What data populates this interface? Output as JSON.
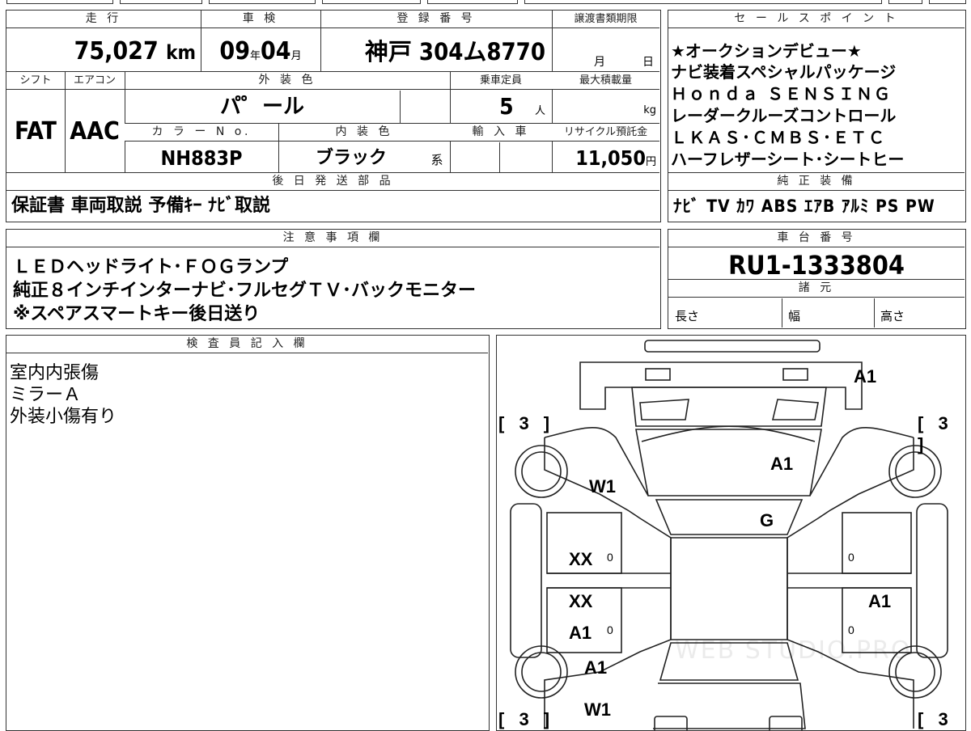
{
  "summary": {
    "headers": {
      "mileage": "走 行",
      "inspection": "車 検",
      "registration": "登 録 番 号",
      "transfer_deadline": "譲渡書類期限",
      "shift": "シフト",
      "aircon": "エアコン",
      "exterior_color": "外 装 色",
      "capacity": "乗車定員",
      "max_load": "最大積載量",
      "color_no": "カ ラ ー N o.",
      "interior_color": "内 装 色",
      "import": "輸 入 車",
      "recycle_fee": "リサイクル預託金",
      "later_parts": "後 日 発 送 部 品"
    },
    "mileage_value": "75,027",
    "mileage_unit": "km",
    "inspection_year": "09",
    "inspection_year_unit": "年",
    "inspection_month": "04",
    "inspection_month_unit": "月",
    "registration_value": "神戸 304ム8770",
    "transfer_month_unit": "月",
    "transfer_day_unit": "日",
    "shift_value": "FAT",
    "aircon_value": "AAC",
    "exterior_color_value": "パ゜ール",
    "capacity_value": "5",
    "capacity_unit": "人",
    "max_load_unit": "kg",
    "color_no_value": "NH883P",
    "interior_color_value": "ブラック",
    "interior_color_suffix": "系",
    "recycle_value": "11,050",
    "recycle_unit": "円",
    "later_parts_value": "保証書 車両取説 予備ｷｰ ﾅﾋﾞ取説"
  },
  "sales_points": {
    "header": "セ ー ル ス ポ イ ン ト",
    "lines": [
      "★オークションデビュー★",
      "ナビ装着スペシャルパッケージ",
      "Ｈｏｎｄａ ＳＥＮＳＩＮＧ",
      "レーダークルーズコントロール",
      "ＬＫＡＳ･ＣＭＢＳ･ＥＴＣ",
      "ハーフレザーシート･シートヒー"
    ]
  },
  "equipment": {
    "header": "純 正 装 備",
    "value": "ﾅﾋﾞ TV ｶﾜ ABS ｴｱB ｱﾙﾐ PS PW"
  },
  "notes": {
    "header": "注 意 事 項 欄",
    "lines": [
      "ＬＥＤヘッドライト･ＦＯＧランプ",
      "純正８インチインターナビ･フルセグＴＶ･バックモニター",
      "※スペアスマートキー後日送り"
    ]
  },
  "chassis": {
    "header": "車 台 番 号",
    "value": "RU1-1333804",
    "specs_header": "諸 元",
    "length_label": "長さ",
    "width_label": "幅",
    "height_label": "高さ"
  },
  "inspector": {
    "header": "検 査 員 記 入 欄",
    "lines": [
      "室内内張傷",
      "ミラーＡ",
      "外装小傷有り"
    ]
  },
  "diagram": {
    "watermark": "WEB STUDIO.PRO",
    "marks": {
      "front_a1": "A1",
      "hood_a1": "A1",
      "windshield_g": "G",
      "left_fender_w1": "W1",
      "left_front_door_xx": "XX",
      "left_front_door_zero": "0",
      "left_rear_door_xx": "XX",
      "left_rear_door_a1": "A1",
      "left_rear_door_zero": "0",
      "right_front_door_zero": "0",
      "right_rear_door_a1": "A1",
      "right_rear_door_zero": "0",
      "left_rear_fender_a1": "A1",
      "left_rear_w1": "W1"
    },
    "tyres": {
      "front_left": "[ 3 ]",
      "front_right": "[ 3 ]",
      "rear_left": "[ 3 ]",
      "rear_right": "[ 3 ]"
    }
  }
}
